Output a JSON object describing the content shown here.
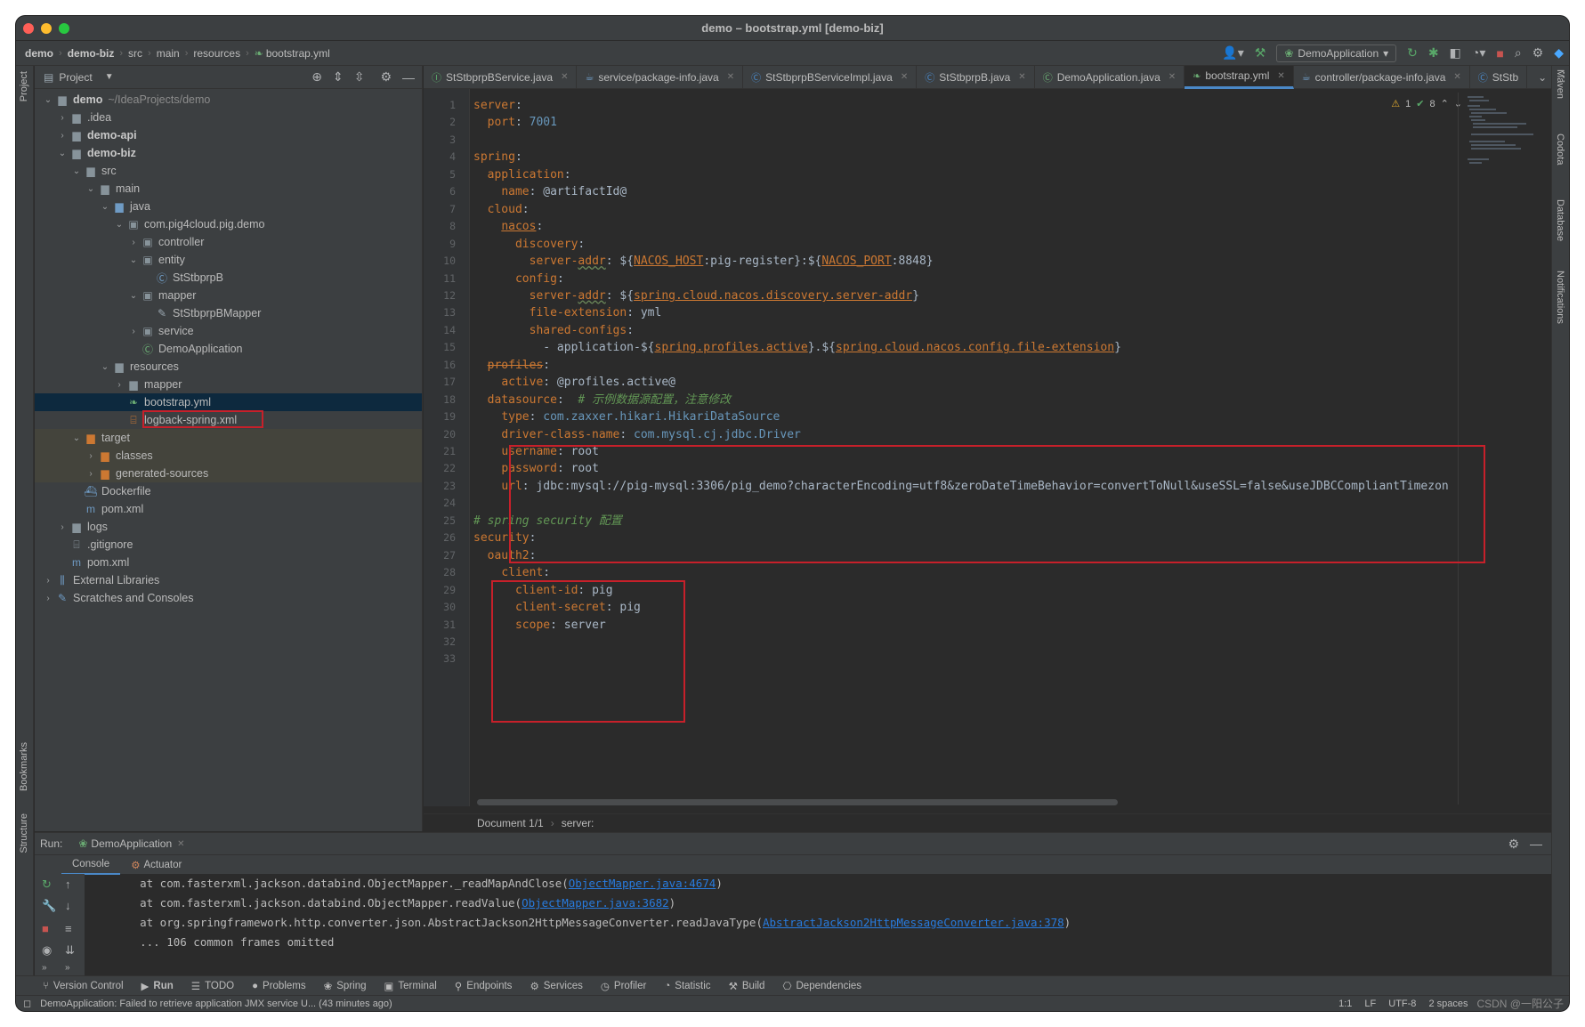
{
  "window": {
    "title": "demo – bootstrap.yml [demo-biz]"
  },
  "breadcrumbs": [
    "demo",
    "demo-biz",
    "src",
    "main",
    "resources",
    "bootstrap.yml"
  ],
  "toolbar": {
    "run_config": "DemoApplication"
  },
  "left_strip": {
    "project": "Project",
    "bookmarks": "Bookmarks",
    "structure": "Structure"
  },
  "right_strip": {
    "maven": "Maven",
    "codota": "Codota",
    "database": "Database",
    "notifications": "Notifications"
  },
  "project": {
    "header": "Project",
    "tree": [
      {
        "label": "demo",
        "hint": "~/IdeaProjects/demo",
        "depth": 0,
        "arrow": "open",
        "icon": "module-folder",
        "bold": true
      },
      {
        "label": ".idea",
        "depth": 1,
        "arrow": "closed",
        "icon": "folder"
      },
      {
        "label": "demo-api",
        "depth": 1,
        "arrow": "closed",
        "icon": "module-folder",
        "bold": true
      },
      {
        "label": "demo-biz",
        "depth": 1,
        "arrow": "open",
        "icon": "module-folder",
        "bold": true
      },
      {
        "label": "src",
        "depth": 2,
        "arrow": "open",
        "icon": "folder"
      },
      {
        "label": "main",
        "depth": 3,
        "arrow": "open",
        "icon": "folder"
      },
      {
        "label": "java",
        "depth": 4,
        "arrow": "open",
        "icon": "source-folder"
      },
      {
        "label": "com.pig4cloud.pig.demo",
        "depth": 5,
        "arrow": "open",
        "icon": "package"
      },
      {
        "label": "controller",
        "depth": 6,
        "arrow": "closed",
        "icon": "package"
      },
      {
        "label": "entity",
        "depth": 6,
        "arrow": "open",
        "icon": "package"
      },
      {
        "label": "StStbprpB",
        "depth": 7,
        "arrow": "none",
        "icon": "class"
      },
      {
        "label": "mapper",
        "depth": 6,
        "arrow": "open",
        "icon": "package"
      },
      {
        "label": "StStbprpBMapper",
        "depth": 7,
        "arrow": "none",
        "icon": "mapper"
      },
      {
        "label": "service",
        "depth": 6,
        "arrow": "closed",
        "icon": "package"
      },
      {
        "label": "DemoApplication",
        "depth": 6,
        "arrow": "none",
        "icon": "spring-class"
      },
      {
        "label": "resources",
        "depth": 4,
        "arrow": "open",
        "icon": "resources-folder"
      },
      {
        "label": "mapper",
        "depth": 5,
        "arrow": "closed",
        "icon": "folder"
      },
      {
        "label": "bootstrap.yml",
        "depth": 5,
        "arrow": "none",
        "icon": "yml",
        "selected": true
      },
      {
        "label": "logback-spring.xml",
        "depth": 5,
        "arrow": "none",
        "icon": "xml"
      },
      {
        "label": "target",
        "depth": 2,
        "arrow": "open",
        "icon": "excluded-folder",
        "excluded": true
      },
      {
        "label": "classes",
        "depth": 3,
        "arrow": "closed",
        "icon": "excluded-folder",
        "excluded": true
      },
      {
        "label": "generated-sources",
        "depth": 3,
        "arrow": "closed",
        "icon": "excluded-folder",
        "excluded": true
      },
      {
        "label": "Dockerfile",
        "depth": 2,
        "arrow": "none",
        "icon": "docker"
      },
      {
        "label": "pom.xml",
        "depth": 2,
        "arrow": "none",
        "icon": "maven"
      },
      {
        "label": "logs",
        "depth": 1,
        "arrow": "closed",
        "icon": "folder"
      },
      {
        "label": ".gitignore",
        "depth": 1,
        "arrow": "none",
        "icon": "gitignore"
      },
      {
        "label": "pom.xml",
        "depth": 1,
        "arrow": "none",
        "icon": "maven"
      },
      {
        "label": "External Libraries",
        "depth": 0,
        "arrow": "closed",
        "icon": "libraries"
      },
      {
        "label": "Scratches and Consoles",
        "depth": 0,
        "arrow": "closed",
        "icon": "scratches"
      }
    ]
  },
  "editor": {
    "tabs": [
      {
        "label": "StStbprpBService.java",
        "icon": "interface"
      },
      {
        "label": "service/package-info.java",
        "icon": "java"
      },
      {
        "label": "StStbprpBServiceImpl.java",
        "icon": "class"
      },
      {
        "label": "StStbprpB.java",
        "icon": "class"
      },
      {
        "label": "DemoApplication.java",
        "icon": "spring"
      },
      {
        "label": "bootstrap.yml",
        "icon": "yml",
        "active": true
      },
      {
        "label": "controller/package-info.java",
        "icon": "java"
      },
      {
        "label": "StStb",
        "icon": "class"
      }
    ],
    "inspections": {
      "warnings": "1",
      "ok": "8"
    },
    "status": {
      "document": "Document 1/1",
      "path": "server:"
    },
    "lines": [
      [
        [
          "k",
          "server"
        ],
        [
          "s",
          ":"
        ]
      ],
      [
        [
          "s",
          "  "
        ],
        [
          "k",
          "port"
        ],
        [
          "s",
          ": "
        ],
        [
          "n",
          "7001"
        ]
      ],
      [],
      [
        [
          "k",
          "spring"
        ],
        [
          "s",
          ":"
        ]
      ],
      [
        [
          "s",
          "  "
        ],
        [
          "k",
          "application"
        ],
        [
          "s",
          ":"
        ]
      ],
      [
        [
          "s",
          "    "
        ],
        [
          "k",
          "name"
        ],
        [
          "s",
          ": @artifactId@"
        ]
      ],
      [
        [
          "s",
          "  "
        ],
        [
          "k",
          "cloud"
        ],
        [
          "s",
          ":"
        ]
      ],
      [
        [
          "s",
          "    "
        ],
        [
          "ku",
          "nacos"
        ],
        [
          "s",
          ":"
        ]
      ],
      [
        [
          "s",
          "      "
        ],
        [
          "k",
          "discovery"
        ],
        [
          "s",
          ":"
        ]
      ],
      [
        [
          "s",
          "        "
        ],
        [
          "k",
          "server-"
        ],
        [
          "kw",
          "addr"
        ],
        [
          "s",
          ": ${"
        ],
        [
          "ku",
          "NACOS_HOST"
        ],
        [
          "s",
          ":pig-register}:${"
        ],
        [
          "ku",
          "NACOS_PORT"
        ],
        [
          "s",
          ":8848}"
        ]
      ],
      [
        [
          "s",
          "      "
        ],
        [
          "k",
          "config"
        ],
        [
          "s",
          ":"
        ]
      ],
      [
        [
          "s",
          "        "
        ],
        [
          "k",
          "server-"
        ],
        [
          "kw",
          "addr"
        ],
        [
          "s",
          ": ${"
        ],
        [
          "ku",
          "spring.cloud.nacos.discovery.server-addr"
        ],
        [
          "s",
          "}"
        ]
      ],
      [
        [
          "s",
          "        "
        ],
        [
          "k",
          "file-extension"
        ],
        [
          "s",
          ": yml"
        ]
      ],
      [
        [
          "s",
          "        "
        ],
        [
          "k",
          "shared-configs"
        ],
        [
          "s",
          ":"
        ]
      ],
      [
        [
          "s",
          "          - application-${"
        ],
        [
          "ku",
          "spring.profiles.active"
        ],
        [
          "s",
          "}.${"
        ],
        [
          "ku",
          "spring.cloud.nacos.config.file-extension"
        ],
        [
          "s",
          "}"
        ]
      ],
      [
        [
          "s",
          "  "
        ],
        [
          "kx",
          "profiles"
        ],
        [
          "s",
          ":"
        ]
      ],
      [
        [
          "s",
          "    "
        ],
        [
          "k",
          "active"
        ],
        [
          "s",
          ": @profiles.active@"
        ]
      ],
      [
        [
          "s",
          "  "
        ],
        [
          "k",
          "datasource"
        ],
        [
          "s",
          ":  "
        ],
        [
          "cm",
          "# 示例数据源配置，注意修改"
        ]
      ],
      [
        [
          "s",
          "    "
        ],
        [
          "k",
          "type"
        ],
        [
          "s",
          ": "
        ],
        [
          "n",
          "com.zaxxer.hikari.HikariDataSource"
        ]
      ],
      [
        [
          "s",
          "    "
        ],
        [
          "k",
          "driver-class-name"
        ],
        [
          "s",
          ": "
        ],
        [
          "n",
          "com.mysql.cj.jdbc.Driver"
        ]
      ],
      [
        [
          "s",
          "    "
        ],
        [
          "k",
          "username"
        ],
        [
          "s",
          ": root"
        ]
      ],
      [
        [
          "s",
          "    "
        ],
        [
          "k",
          "password"
        ],
        [
          "s",
          ": root"
        ]
      ],
      [
        [
          "s",
          "    "
        ],
        [
          "k",
          "url"
        ],
        [
          "s",
          ": jdbc:mysql://pig-mysql:3306/pig_demo?characterEncoding=utf8&zeroDateTimeBehavior=convertToNull&useSSL=false&useJDBCCompliantTimezon"
        ]
      ],
      [],
      [
        [
          "cm",
          "# spring security 配置"
        ]
      ],
      [
        [
          "k",
          "security"
        ],
        [
          "s",
          ":"
        ]
      ],
      [
        [
          "s",
          "  "
        ],
        [
          "k",
          "oauth2"
        ],
        [
          "s",
          ":"
        ]
      ],
      [
        [
          "s",
          "    "
        ],
        [
          "k",
          "client"
        ],
        [
          "s",
          ":"
        ]
      ],
      [
        [
          "s",
          "      "
        ],
        [
          "k",
          "client-id"
        ],
        [
          "s",
          ": pig"
        ]
      ],
      [
        [
          "s",
          "      "
        ],
        [
          "k",
          "client-secret"
        ],
        [
          "s",
          ": pig"
        ]
      ],
      [
        [
          "s",
          "      "
        ],
        [
          "k",
          "scope"
        ],
        [
          "s",
          ": server"
        ]
      ],
      [],
      []
    ]
  },
  "run": {
    "label": "Run:",
    "config": "DemoApplication",
    "tabs": [
      "Console",
      "Actuator"
    ],
    "console": [
      {
        "text": "    at com.fasterxml.jackson.databind.ObjectMapper._readMapAndClose(",
        "link": "ObjectMapper.java:4674",
        "tail": ")"
      },
      {
        "text": "    at com.fasterxml.jackson.databind.ObjectMapper.readValue(",
        "link": "ObjectMapper.java:3682",
        "tail": ")"
      },
      {
        "text": "    at org.springframework.http.converter.json.AbstractJackson2HttpMessageConverter.readJavaType(",
        "link": "AbstractJackson2HttpMessageConverter.java:378",
        "tail": ")"
      },
      {
        "text": "    ... 106 common frames omitted",
        "link": "",
        "tail": ""
      }
    ]
  },
  "bottom_tools": [
    "Version Control",
    "Run",
    "TODO",
    "Problems",
    "Spring",
    "Terminal",
    "Endpoints",
    "Services",
    "Profiler",
    "Statistic",
    "Build",
    "Dependencies"
  ],
  "status_bar": {
    "message": "DemoApplication: Failed to retrieve application JMX service U... (43 minutes ago)",
    "position": "1:1",
    "line_sep": "LF",
    "encoding": "UTF-8",
    "indent": "2 spaces",
    "watermark": "CSDN @一阳公子"
  }
}
